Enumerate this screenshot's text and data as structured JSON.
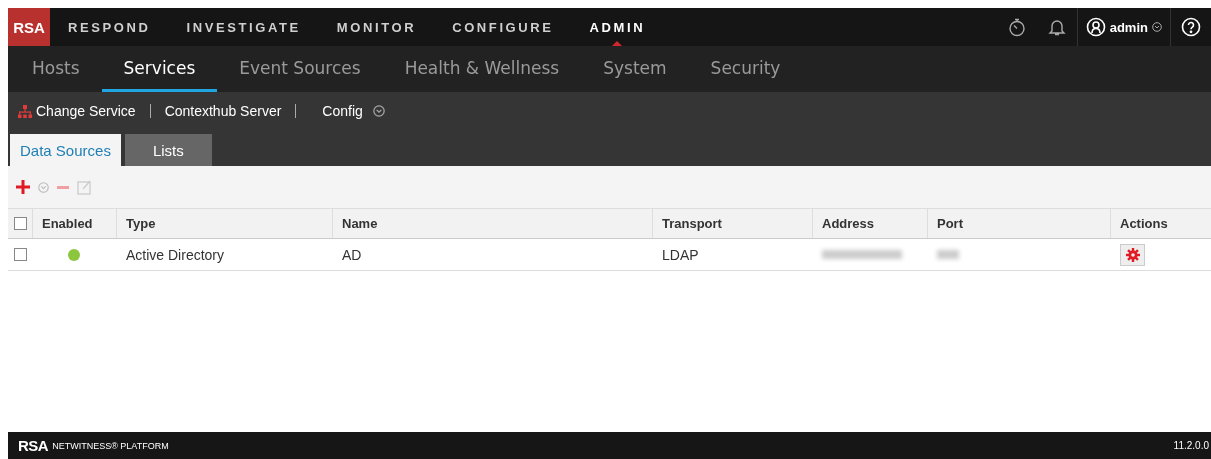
{
  "top_nav": {
    "logo": "RSA",
    "items": [
      {
        "label": "RESPOND",
        "selected": false
      },
      {
        "label": "INVESTIGATE",
        "selected": false
      },
      {
        "label": "MONITOR",
        "selected": false
      },
      {
        "label": "CONFIGURE",
        "selected": false
      },
      {
        "label": "ADMIN",
        "selected": true
      }
    ],
    "user": "admin"
  },
  "sub_nav": [
    {
      "label": "Hosts",
      "selected": false
    },
    {
      "label": "Services",
      "selected": true
    },
    {
      "label": "Event Sources",
      "selected": false
    },
    {
      "label": "Health & Wellness",
      "selected": false
    },
    {
      "label": "System",
      "selected": false
    },
    {
      "label": "Security",
      "selected": false
    }
  ],
  "service_bar": {
    "change_service": "Change Service",
    "service": "Contexthub Server",
    "config": "Config"
  },
  "tabs": [
    {
      "label": "Data Sources",
      "selected": true
    },
    {
      "label": "Lists",
      "selected": false
    }
  ],
  "table": {
    "select_all_checked": false,
    "columns": [
      "Enabled",
      "Type",
      "Name",
      "Transport",
      "Address",
      "Port",
      "Actions"
    ],
    "rows": [
      {
        "checked": false,
        "enabled": true,
        "type": "Active Directory",
        "name": "AD",
        "transport": "LDAP"
      }
    ]
  },
  "footer": {
    "logo": "RSA",
    "product": "NETWITNESS® PLATFORM",
    "version": "11.2.0.0"
  }
}
